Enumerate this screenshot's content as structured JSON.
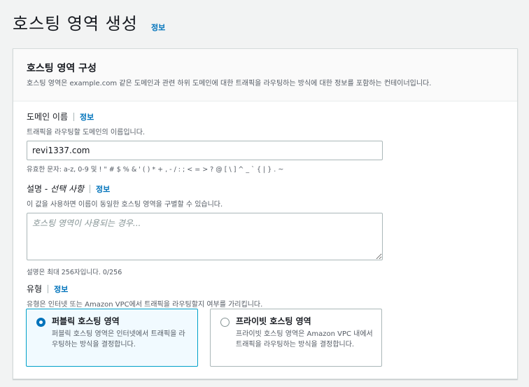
{
  "page": {
    "title": "호스팅 영역 생성",
    "info_label": "정보"
  },
  "panel": {
    "title": "호스팅 영역 구성",
    "description": "호스팅 영역은 example.com 같은 도메인과 관련 하위 도메인에 대한 트래픽을 라우팅하는 방식에 대한 정보를 포함하는 컨테이너입니다."
  },
  "domain": {
    "label": "도메인 이름",
    "info_label": "정보",
    "hint": "트래픽을 라우팅할 도메인의 이름입니다.",
    "value": "revi1337.com",
    "constraint": "유효한 문자: a-z, 0-9 및 ! \" # $ % & ' ( ) * + , - / : ; < = > ? @ [ \\ ] ^ _ ` { | } . ~"
  },
  "description_field": {
    "label": "설명 - ",
    "optional_label": "선택 사항",
    "info_label": "정보",
    "hint": "이 값을 사용하면 이름이 동일한 호스팅 영역을 구별할 수 있습니다.",
    "placeholder": "호스팅 영역이 사용되는 경우...",
    "constraint": "설명은 최대 256자입니다. 0/256"
  },
  "type": {
    "label": "유형",
    "info_label": "정보",
    "hint": "유형은 인터넷 또는 Amazon VPC에서 트래픽을 라우팅할지 여부를 가리킵니다.",
    "options": [
      {
        "title": "퍼블릭 호스팅 영역",
        "description": "퍼블릭 호스팅 영역은 인터넷에서 트래픽을 라우팅하는 방식을 결정합니다.",
        "selected": true
      },
      {
        "title": "프라이빗 호스팅 영역",
        "description": "프라이빗 호스팅 영역은 Amazon VPC 내에서 트래픽을 라우팅하는 방식을 결정합니다.",
        "selected": false
      }
    ]
  },
  "colors": {
    "accent": "#0073bb",
    "selected_tile_bg": "#f1faff",
    "selected_tile_border": "#00a1c9"
  }
}
